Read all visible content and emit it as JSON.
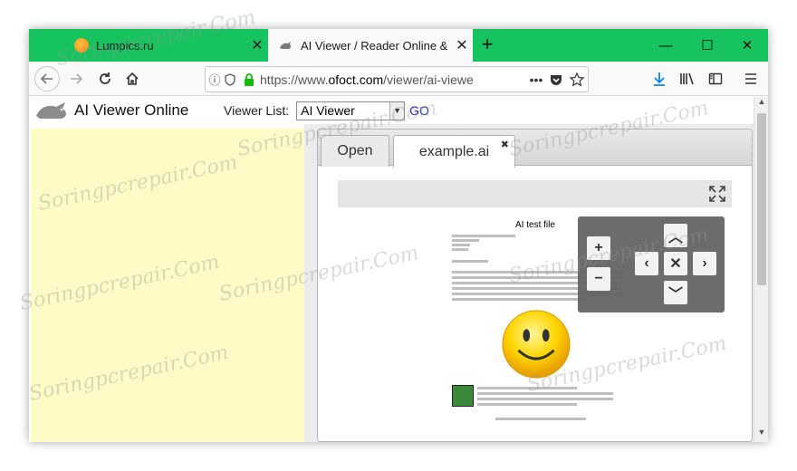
{
  "tabs": [
    {
      "title": "Lumpics.ru",
      "close": "✕"
    },
    {
      "title": "AI Viewer / Reader Online & Fre",
      "close": "✕"
    }
  ],
  "new_tab_label": "+",
  "window_buttons": {
    "minimize": "—",
    "maximize": "☐",
    "close": "✕"
  },
  "address_bar": {
    "url_prefix": "https://www.",
    "url_domain": "ofoct.com",
    "url_path": "/viewer/ai-viewe",
    "more": "•••"
  },
  "site": {
    "title": "AI Viewer Online",
    "viewer_list_label": "Viewer List:",
    "selected_viewer": "AI Viewer",
    "go_label": "GO"
  },
  "viewer": {
    "tab_open": "Open",
    "tab_file": "example.ai",
    "tab_file_close": "✖",
    "document": {
      "title": "AI test file"
    },
    "controls": {
      "zoom_in": "+",
      "zoom_out": "−",
      "up": "︿",
      "down": "﹀",
      "left": "‹",
      "right": "›",
      "reset": "✕"
    }
  },
  "watermark": "Soringpcrepair.Com",
  "colors": {
    "tabstrip": "#16c35f",
    "side_panel": "#fffbc6",
    "link": "#2a2ab8"
  }
}
